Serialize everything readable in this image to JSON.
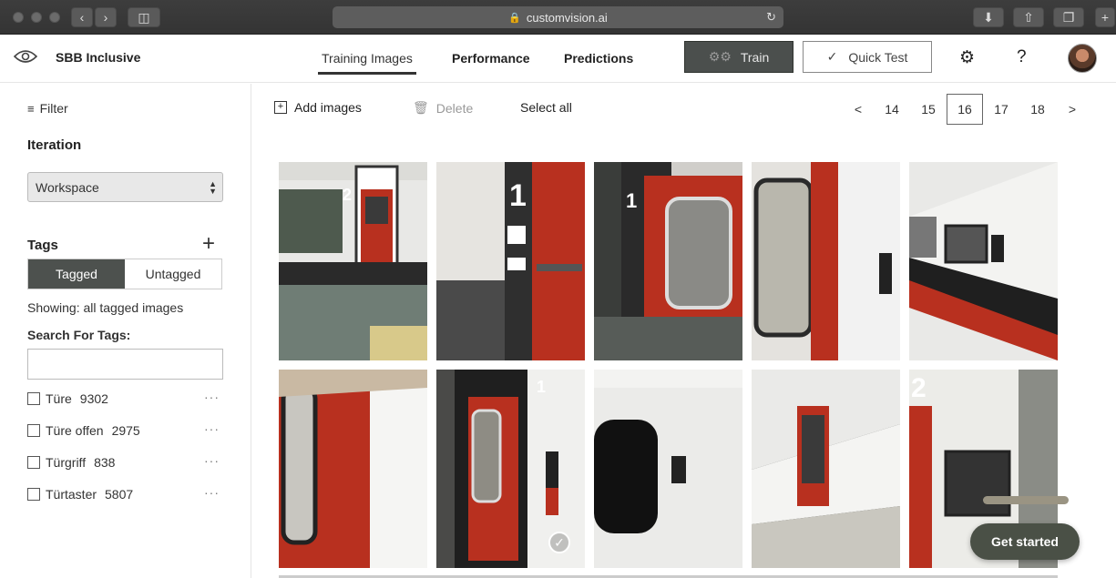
{
  "browser": {
    "url": "customvision.ai"
  },
  "header": {
    "project_name": "SBB Inclusive",
    "tabs": [
      {
        "label": "Training Images",
        "active": true
      },
      {
        "label": "Performance",
        "active": false
      },
      {
        "label": "Predictions",
        "active": false
      }
    ],
    "train_label": "Train",
    "quick_test_label": "Quick Test",
    "help_label": "?"
  },
  "sidebar": {
    "filter_label": "Filter",
    "iteration_title": "Iteration",
    "iteration_selected": "Workspace",
    "tags_title": "Tags",
    "tagged_label": "Tagged",
    "untagged_label": "Untagged",
    "showing_text": "Showing: all tagged images",
    "search_label": "Search For Tags:",
    "search_value": "",
    "tags": [
      {
        "name": "Türe",
        "count": "9302",
        "more": "···"
      },
      {
        "name": "Türe offen",
        "count": "2975",
        "more": "···"
      },
      {
        "name": "Türgriff",
        "count": "838",
        "more": "···"
      },
      {
        "name": "Türtaster",
        "count": "5807",
        "more": "···"
      }
    ]
  },
  "toolbar": {
    "add_images_label": "Add images",
    "delete_label": "Delete",
    "select_all_label": "Select all"
  },
  "pagination": {
    "prev": "<",
    "pages": [
      "14",
      "15",
      "16",
      "17",
      "18"
    ],
    "current": "16",
    "next": ">"
  },
  "get_started_label": "Get started",
  "colors": {
    "train_bg": "#4b4f4d",
    "tagged_bg": "#4d514e",
    "sbb_red": "#b8301f"
  }
}
